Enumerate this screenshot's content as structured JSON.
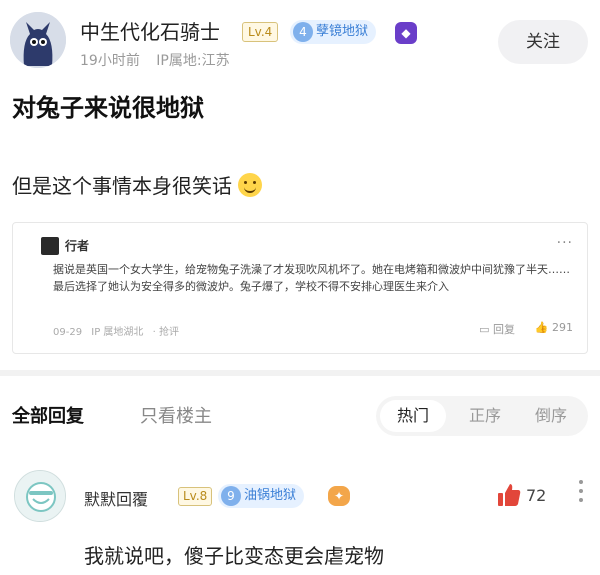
{
  "author": {
    "name": "中生代化石骑士",
    "level": "Lv.4",
    "title_num": "4",
    "title": "孽镜地狱",
    "time": "19小时前",
    "ip": "IP属地:江苏",
    "follow_label": "关注"
  },
  "post": {
    "title": "对兔子来说很地狱",
    "body": "但是这个事情本身很笑话"
  },
  "quote": {
    "author": "行者",
    "text": "据说是英国一个女大学生，给宠物兔子洗澡了才发现吹风机坏了。她在电烤箱和微波炉中间犹豫了半天……最后选择了她认为安全得多的微波炉。兔子爆了，学校不得不安排心理医生来介入",
    "date": "09-29",
    "ip": "IP 属地湖北",
    "extra": "· 抢评",
    "reply_label": "回复",
    "likes": "291",
    "more": "···"
  },
  "tabs": {
    "all": "全部回复",
    "op_only": "只看楼主",
    "sort_hot": "热门",
    "sort_asc": "正序",
    "sort_desc": "倒序"
  },
  "comment": {
    "name": "默默回覆",
    "level": "Lv.8",
    "title_num": "9",
    "title": "油锅地狱",
    "likes": "72",
    "text": "我就说吧，傻子比变态更会虐宠物"
  },
  "colors": {
    "like_red": "#e2463a",
    "badge_blue": "#3a7fd6",
    "level_gold": "#b98b1b"
  }
}
